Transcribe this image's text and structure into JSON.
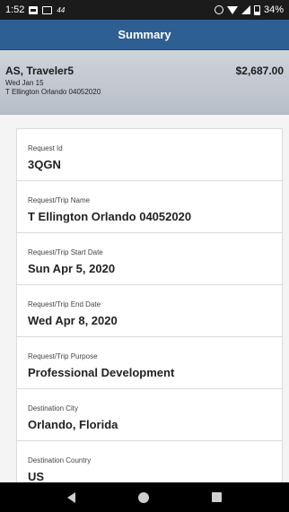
{
  "status_bar": {
    "time": "1:52",
    "network_label": "44",
    "battery_percent": "34%",
    "icons": [
      "message-icon",
      "news-icon",
      "alarm-icon",
      "wifi-icon",
      "signal-icon",
      "battery-icon"
    ]
  },
  "header": {
    "title": "Summary",
    "background_color": "#2e5f92"
  },
  "banner": {
    "traveler": "AS, Traveler5",
    "amount": "$2,687.00",
    "date": "Wed Jan 15",
    "trip_name": "T Ellington Orlando 04052020"
  },
  "fields": [
    {
      "label": "Request Id",
      "value": "3QGN"
    },
    {
      "label": "Request/Trip Name",
      "value": "T Ellington Orlando 04052020"
    },
    {
      "label": "Request/Trip Start Date",
      "value": "Sun Apr 5, 2020"
    },
    {
      "label": "Request/Trip End Date",
      "value": "Wed Apr 8, 2020"
    },
    {
      "label": "Request/Trip Purpose",
      "value": "Professional Development"
    },
    {
      "label": "Destination City",
      "value": "Orlando, Florida"
    },
    {
      "label": "Destination Country",
      "value": "US"
    }
  ],
  "nav_bar": {
    "icons": [
      "back-icon",
      "home-icon",
      "recents-icon"
    ]
  }
}
